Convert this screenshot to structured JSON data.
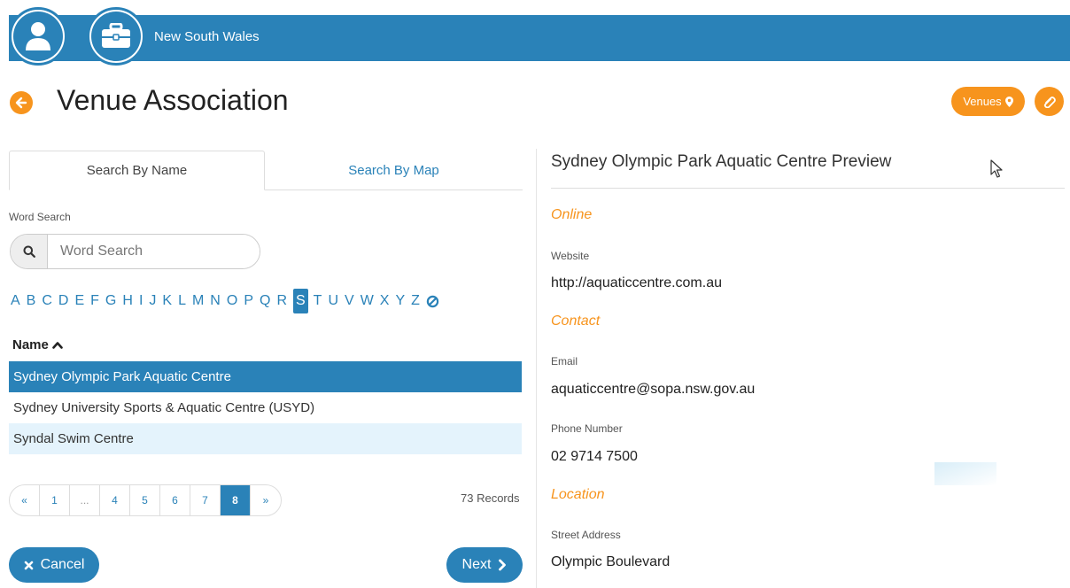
{
  "header": {
    "org_name": "New South Wales",
    "profile_icon": "user-icon",
    "org_icon": "briefcase-icon",
    "bar_color": "#2a82b8"
  },
  "page": {
    "title": "Venue Association",
    "back_icon": "arrow-left-icon",
    "venues_label": "Venues",
    "accent_color": "#f7941d"
  },
  "tabs": [
    {
      "label": "Search By Name",
      "active": true
    },
    {
      "label": "Search By Map",
      "active": false
    }
  ],
  "search": {
    "label": "Word Search",
    "placeholder": "Word Search",
    "value": ""
  },
  "alphabet": {
    "letters": [
      "A",
      "B",
      "C",
      "D",
      "E",
      "F",
      "G",
      "H",
      "I",
      "J",
      "K",
      "L",
      "M",
      "N",
      "O",
      "P",
      "Q",
      "R",
      "S",
      "T",
      "U",
      "V",
      "W",
      "X",
      "Y",
      "Z"
    ],
    "selected": "S",
    "clear_icon": "ban-icon"
  },
  "list": {
    "header": "Name",
    "sort": "ascending",
    "rows": [
      {
        "name": "Sydney Olympic Park Aquatic Centre",
        "selected": true
      },
      {
        "name": "Sydney University Sports & Aquatic Centre (USYD)",
        "selected": false
      },
      {
        "name": "Syndal Swim Centre",
        "selected": false
      }
    ]
  },
  "pagination": {
    "prev": "«",
    "items": [
      "1",
      "...",
      "4",
      "5",
      "6",
      "7",
      "8"
    ],
    "current": "8",
    "next": "»",
    "records": "73 Records"
  },
  "actions": {
    "cancel": "Cancel",
    "next": "Next"
  },
  "preview": {
    "title": "Sydney Olympic Park Aquatic Centre Preview",
    "online_heading": "Online",
    "website_label": "Website",
    "website": "http://aquaticcentre.com.au",
    "contact_heading": "Contact",
    "email_label": "Email",
    "email": "aquaticcentre@sopa.nsw.gov.au",
    "phone_label": "Phone Number",
    "phone": "02 9714 7500",
    "location_heading": "Location",
    "street_label": "Street Address",
    "street": "Olympic Boulevard"
  }
}
